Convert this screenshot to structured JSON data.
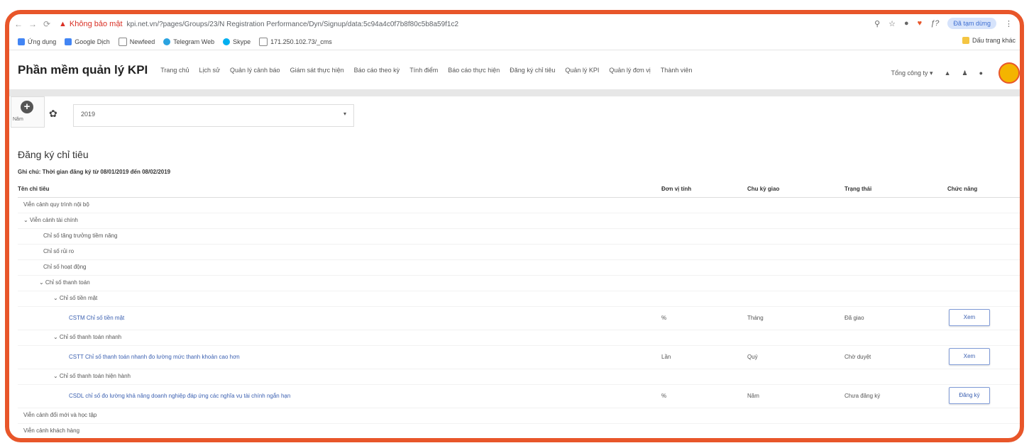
{
  "browser": {
    "warning": "Không bảo mật",
    "url": "kpi.net.vn/?pages/Groups/23/N Registration Performance/Dyn/Signup/data:5c94a4c0f7b8f80c5b8a59f1c2",
    "profile_label": "Đã tạm dừng"
  },
  "bookmarks": {
    "items": [
      {
        "label": "Ứng dụng",
        "color": "#4285f4"
      },
      {
        "label": "Google Dịch",
        "color": "#4285f4"
      },
      {
        "label": "Newfeed",
        "color": "#888888"
      },
      {
        "label": "Telegram Web",
        "color": "#2aa3e0"
      },
      {
        "label": "Skype",
        "color": "#00aff0"
      },
      {
        "label": "171.250.102.73/_cms",
        "color": "#888888"
      }
    ],
    "right_label": "Dấu trang khác"
  },
  "app": {
    "brand": "Phần mềm quản lý KPI",
    "menu": [
      "Trang chủ",
      "Lịch sử",
      "Quản lý cảnh báo",
      "Giám sát thực hiện",
      "Báo cáo theo kỳ",
      "Tính điểm",
      "Báo cáo thực hiện",
      "Đăng ký chỉ tiêu",
      "Quản lý KPI",
      "Quản lý đơn vị",
      "Thành viên"
    ],
    "org_select": "Tổng công ty",
    "icons": [
      "bell-icon",
      "users-icon",
      "chat-icon",
      "avatar"
    ]
  },
  "filter": {
    "add_label": "Năm",
    "year_value": "2019"
  },
  "page": {
    "title": "Đăng ký chỉ tiêu",
    "note": "Ghi chú: Thời gian đăng ký từ 08/01/2019 đến 08/02/2019"
  },
  "table": {
    "headers": {
      "name": "Tên chỉ tiêu",
      "unit": "Đơn vị tính",
      "cycle": "Chu kỳ giao",
      "status": "Trạng thái",
      "action": "Chức năng"
    },
    "rows": [
      {
        "name": "Viễn cảnh quy trình nội bộ"
      },
      {
        "name": "⌄ Viễn cảnh tài chính"
      },
      {
        "name": "Chỉ số tăng trưởng tiềm năng"
      },
      {
        "name": "Chỉ số rủi ro"
      },
      {
        "name": "Chỉ số hoạt động"
      },
      {
        "name": "⌄ Chỉ số thanh toán"
      },
      {
        "name": "⌄ Chỉ số tiền mặt"
      },
      {
        "name": "CSTM Chỉ số tiền mặt",
        "unit": "%",
        "cycle": "Tháng",
        "status": "Đã giao",
        "action": "Xem"
      },
      {
        "name": "⌄ Chỉ số thanh toán nhanh"
      },
      {
        "name": "CSTT Chỉ số thanh toán nhanh đo lường mức thanh khoản cao hơn",
        "unit": "Lần",
        "cycle": "Quý",
        "status": "Chờ duyệt",
        "action": "Xem"
      },
      {
        "name": "⌄ Chỉ số thanh toán hiện hành"
      },
      {
        "name": "CSDL chỉ số đo lường khả năng doanh nghiệp đáp ứng các nghĩa vụ tài chính ngắn hạn",
        "unit": "%",
        "cycle": "Năm",
        "status": "Chưa đăng ký",
        "action": "Đăng ký"
      },
      {
        "name": "Viễn cảnh đổi mới và học tập"
      },
      {
        "name": "Viễn cảnh khách hàng"
      }
    ]
  }
}
